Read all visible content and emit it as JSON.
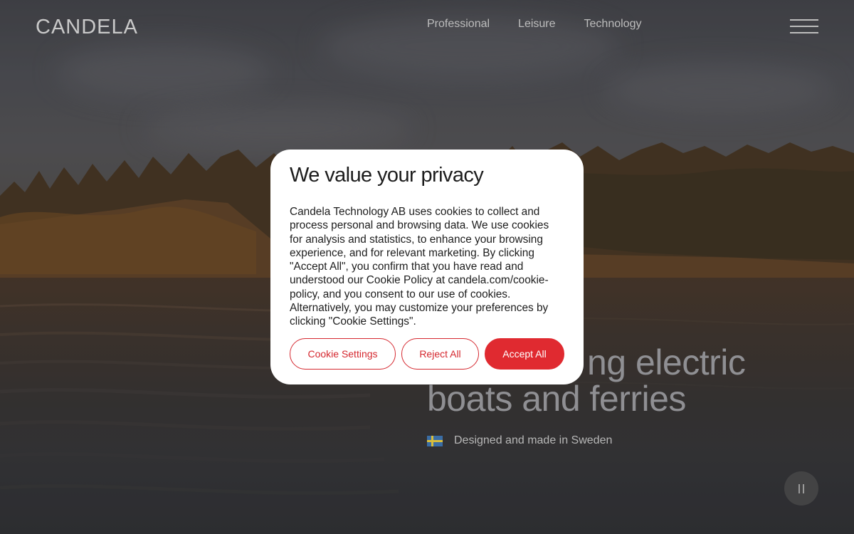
{
  "header": {
    "logo": "CANDELA",
    "nav": [
      "Professional",
      "Leisure",
      "Technology"
    ]
  },
  "hero": {
    "title_line1": "ng electric",
    "title_line2": "boats and ferries",
    "tagline": "Designed and made in Sweden"
  },
  "cookie": {
    "title": "We value your privacy",
    "body": "Candela Technology AB uses cookies to collect and process personal and browsing data. We use cookies for analysis and statistics, to enhance your browsing experience, and for relevant marketing. By clicking \"Accept All\", you confirm that you have read and understood our Cookie Policy at candela.com/cookie-policy, and you consent to our use of cookies. Alternatively, you may customize your preferences by clicking \"Cookie Settings\".",
    "settings_label": "Cookie Settings",
    "reject_label": "Reject All",
    "accept_label": "Accept All"
  },
  "colors": {
    "accent": "#e02a30",
    "modal_bg": "#ffffff"
  },
  "icons": {
    "menu": "hamburger-icon",
    "pause": "pause-icon",
    "flag": "sweden-flag-icon"
  }
}
